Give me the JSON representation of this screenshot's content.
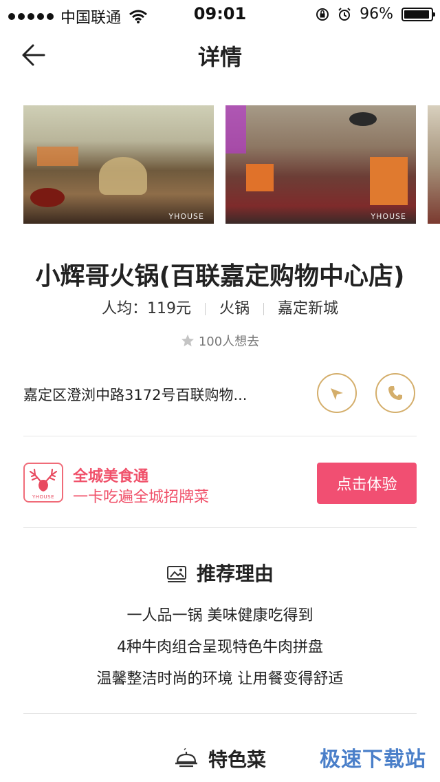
{
  "status_bar": {
    "carrier": "中国联通",
    "time": "09:01",
    "battery": "96%",
    "battery_level": 0.96
  },
  "nav": {
    "title": "详情"
  },
  "gallery": {
    "watermark": "YHOUSE",
    "photos": [
      "restaurant-photo-1",
      "restaurant-photo-2",
      "restaurant-photo-3"
    ]
  },
  "shop": {
    "name": "小辉哥火锅(百联嘉定购物中心店)",
    "avg_price": "人均：119元",
    "cuisine": "火锅",
    "area": "嘉定新城",
    "want": "100人想去",
    "address": "嘉定区澄浏中路3172号百联购物..."
  },
  "promo": {
    "logo_text": "YHOUSE",
    "title": "全城美食通",
    "subtitle": "一卡吃遍全城招牌菜",
    "button": "点击体验"
  },
  "reasons": {
    "heading": "推荐理由",
    "items": [
      "一人品一锅 美味健康吃得到",
      "4种牛肉组合呈现特色牛肉拼盘",
      "温馨整洁时尚的环境 让用餐变得舒适"
    ]
  },
  "dishes": {
    "heading": "特色菜"
  },
  "site_watermark": "极速下载站",
  "colors": {
    "accent_gold": "#d4ae6b",
    "promo_pink": "#f14f72",
    "watermark_blue": "#4a7fc9"
  }
}
